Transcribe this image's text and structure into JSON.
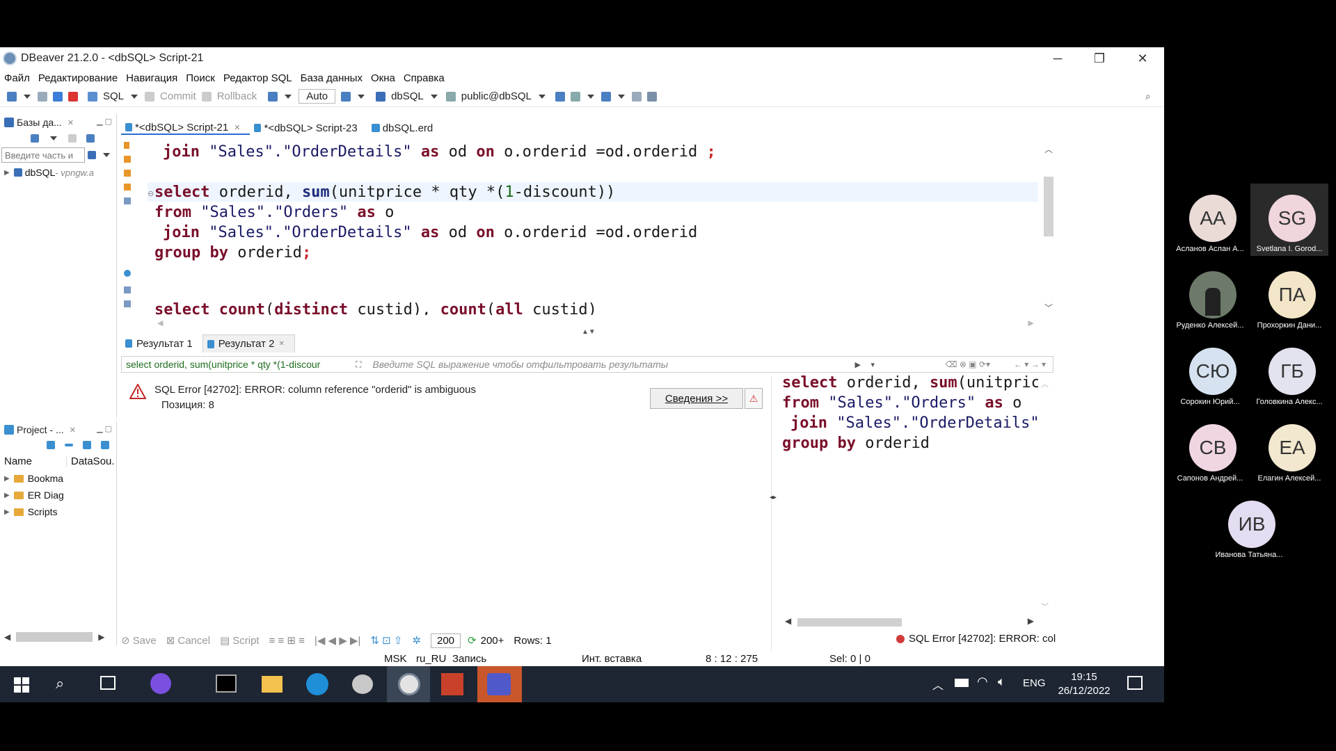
{
  "window": {
    "title": "DBeaver 21.2.0 - <dbSQL> Script-21",
    "minimize": "─",
    "restore": "❐",
    "close": "✕"
  },
  "menu": [
    "Файл",
    "Редактирование",
    "Навигация",
    "Поиск",
    "Редактор SQL",
    "База данных",
    "Окна",
    "Справка"
  ],
  "toolbar": {
    "sql": "SQL",
    "commit": "Commit",
    "rollback": "Rollback",
    "auto": "Auto",
    "datasource": "dbSQL",
    "schema": "public@dbSQL"
  },
  "db_panel": {
    "title": "Базы да...",
    "filter_placeholder": "Введите часть и",
    "tree": [
      {
        "label": "dbSQL",
        "suffix": " - vpngw.a"
      }
    ]
  },
  "project_panel": {
    "title": "Project - ...",
    "col_name": "Name",
    "col_datasource": "DataSou.",
    "items": [
      "Bookma",
      "ER Diag",
      "Scripts"
    ]
  },
  "editor_tabs": [
    "*<dbSQL> Script-21",
    "*<dbSQL> Script-23",
    "dbSQL.erd"
  ],
  "code": {
    "l1": [
      "join",
      " \"Sales\".\"OrderDetails\" ",
      "as",
      " od ",
      "on",
      " o.orderid =od.orderid ",
      ";"
    ],
    "l2_kw": "select",
    "l2_rest1": " orderid, ",
    "l2_fn": "sum",
    "l2_rest2": "(unitprice * qty *(",
    "l2_num": "1",
    "l2_rest3": "-discount))",
    "l3": [
      "from",
      " \"Sales\".\"Orders\" ",
      "as",
      " o"
    ],
    "l4": [
      "join",
      " \"Sales\".\"OrderDetails\" ",
      "as",
      " od ",
      "on",
      " o.orderid =od.orderid"
    ],
    "l5": [
      "group by",
      " orderid",
      ";"
    ],
    "l6": [
      "select",
      " ",
      "count",
      "(",
      "distinct",
      " custid), ",
      "count",
      "(",
      "all",
      " custid)"
    ]
  },
  "result_tabs": [
    "Результат 1",
    "Результат 2"
  ],
  "filter": {
    "query": "select orderid, sum(unitprice * qty *(1-discour",
    "placeholder": "Введите SQL выражение чтобы отфильтровать результаты"
  },
  "error": {
    "message": "SQL Error [42702]: ERROR: column reference \"orderid\" is ambiguous",
    "position": "Позиция: 8",
    "details_button": "Сведения >>"
  },
  "preview": {
    "p1": [
      "select",
      " orderid, ",
      "sum",
      "(unitpric"
    ],
    "p2": [
      "from",
      " \"Sales\".\"Orders\" ",
      "as",
      " o"
    ],
    "p3": [
      "join",
      " \"Sales\".\"OrderDetails\""
    ],
    "p4": [
      "group by",
      " orderid"
    ]
  },
  "bottom": {
    "save": "Save",
    "cancel": "Cancel",
    "script": "Script",
    "limit": "200",
    "fetched": "200+",
    "rows": "Rows: 1",
    "status_error": "SQL Error [42702]: ERROR: col"
  },
  "statusbar": {
    "tz": "MSK",
    "locale": "ru_RU",
    "mode": "Запись",
    "insert": "Инт. вставка",
    "position": "8 : 12 : 275",
    "sel": "Sel: 0 | 0"
  },
  "taskbar": {
    "lang": "ENG",
    "time": "19:15",
    "date": "26/12/2022"
  },
  "participants": [
    {
      "initials": "АА",
      "name": "Асланов Аслан А...",
      "color": "#eadbd6"
    },
    {
      "initials": "SG",
      "name": "Svetlana I. Gorod...",
      "color": "#f0d6dc"
    },
    {
      "initials": "",
      "name": "Руденко Алексей...",
      "color": "#6d7a6a"
    },
    {
      "initials": "ПА",
      "name": "Прохоркин Дани...",
      "color": "#f3e6c8"
    },
    {
      "initials": "СЮ",
      "name": "Сорокин Юрий...",
      "color": "#d6e2f0"
    },
    {
      "initials": "ГБ",
      "name": "Головкина Алекс...",
      "color": "#e3e3ef"
    },
    {
      "initials": "СВ",
      "name": "Сапонов Андрей...",
      "color": "#f0d6e3"
    },
    {
      "initials": "ЕА",
      "name": "Елагин Алексей...",
      "color": "#f1e8cf"
    },
    {
      "initials": "ИВ",
      "name": "Иванова Татьяна...",
      "color": "#e4dcf0"
    }
  ]
}
